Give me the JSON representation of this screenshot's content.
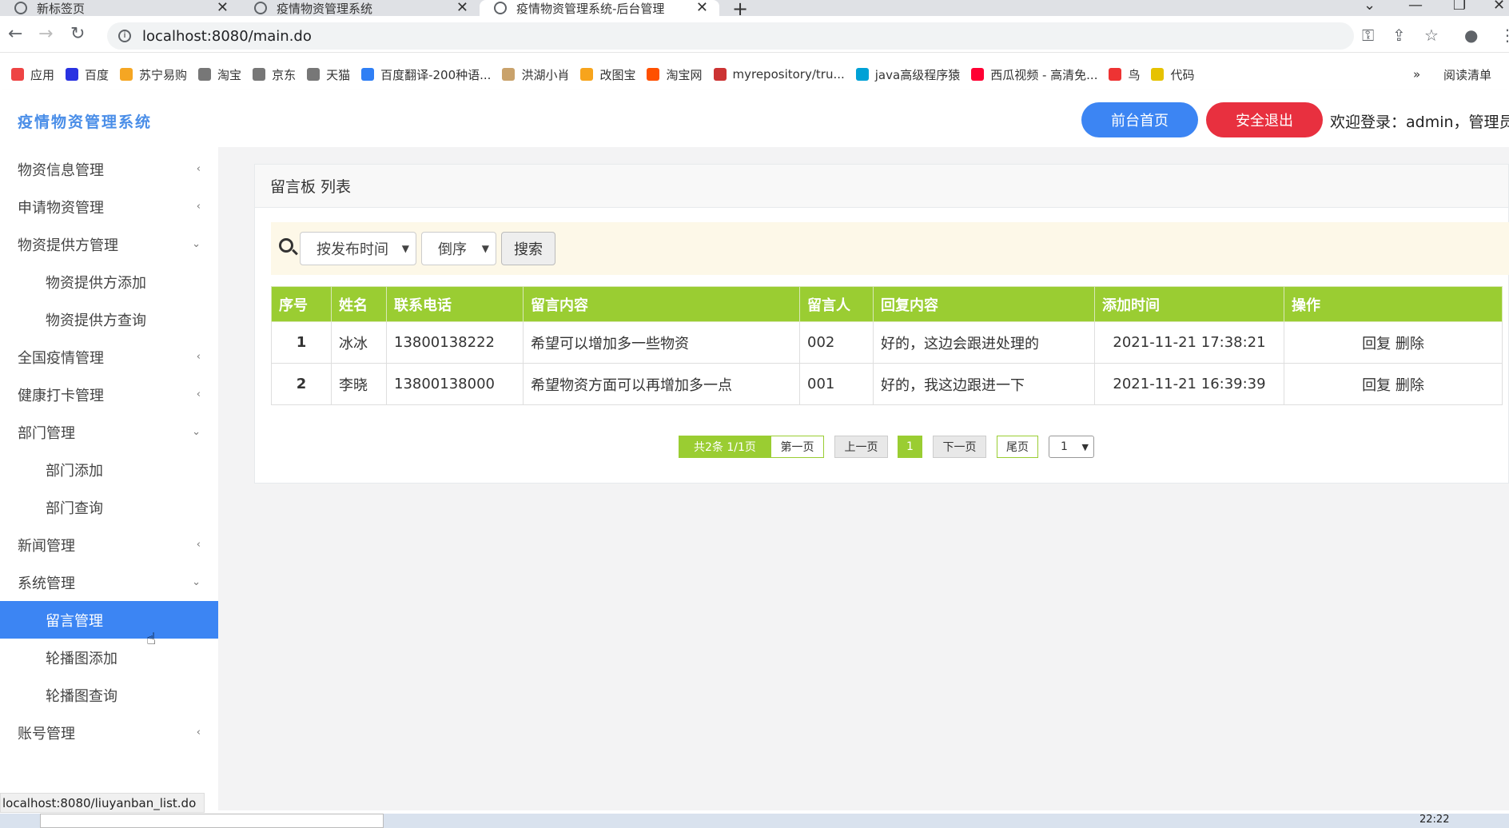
{
  "browser": {
    "tabs": [
      {
        "title": "新标签页"
      },
      {
        "title": "疫情物资管理系统"
      },
      {
        "title": "疫情物资管理系统-后台管理"
      }
    ],
    "url": "localhost:8080/main.do",
    "bookmarks": [
      {
        "label": "应用",
        "color": "#e44"
      },
      {
        "label": "百度",
        "color": "#2932e1"
      },
      {
        "label": "苏宁易购",
        "color": "#f5a623"
      },
      {
        "label": "淘宝",
        "color": "#777"
      },
      {
        "label": "京东",
        "color": "#777"
      },
      {
        "label": "天猫",
        "color": "#777"
      },
      {
        "label": "百度翻译-200种语...",
        "color": "#2f7ff5"
      },
      {
        "label": "洪湖小肖",
        "color": "#c9a26b"
      },
      {
        "label": "改图宝",
        "color": "#f7a41c"
      },
      {
        "label": "淘宝网",
        "color": "#ff5000"
      },
      {
        "label": "myrepository/tru...",
        "color": "#c33"
      },
      {
        "label": "java高级程序猿",
        "color": "#00a1d6"
      },
      {
        "label": "西瓜视频 - 高清免...",
        "color": "#f03"
      },
      {
        "label": "鸟",
        "color": "#e33"
      },
      {
        "label": "代码",
        "color": "#e6c200"
      }
    ],
    "reading_list": "阅读清单",
    "more": "»",
    "status_url": "localhost:8080/liuyanban_list.do"
  },
  "header": {
    "logo": "疫情物资管理系统",
    "home_btn": "前台首页",
    "logout_btn": "安全退出",
    "welcome": "欢迎登录：admin，管理员"
  },
  "sidebar": {
    "items": [
      {
        "label": "物资信息管理",
        "chevron": "‹"
      },
      {
        "label": "申请物资管理",
        "chevron": "‹"
      },
      {
        "label": "物资提供方管理",
        "chevron": "⌄"
      },
      {
        "label": "物资提供方添加"
      },
      {
        "label": "物资提供方查询"
      },
      {
        "label": "全国疫情管理",
        "chevron": "‹"
      },
      {
        "label": "健康打卡管理",
        "chevron": "‹"
      },
      {
        "label": "部门管理",
        "chevron": "⌄"
      },
      {
        "label": "部门添加"
      },
      {
        "label": "部门查询"
      },
      {
        "label": "新闻管理",
        "chevron": "‹"
      },
      {
        "label": "系统管理",
        "chevron": "⌄"
      },
      {
        "label": "留言管理"
      },
      {
        "label": "轮播图添加"
      },
      {
        "label": "轮播图查询"
      },
      {
        "label": "账号管理",
        "chevron": "‹"
      }
    ]
  },
  "panel": {
    "title": "留言板 列表",
    "sort_field": "按发布时间",
    "sort_order": "倒序",
    "search_btn": "搜索"
  },
  "table": {
    "headers": [
      "序号",
      "姓名",
      "联系电话",
      "留言内容",
      "留言人",
      "回复内容",
      "添加时间",
      "操作"
    ],
    "rows": [
      {
        "no": "1",
        "name": "冰冰",
        "phone": "13800138222",
        "content": "希望可以增加多一些物资",
        "author": "002",
        "reply": "好的，这边会跟进处理的",
        "time": "2021-11-21 17:38:21",
        "op_reply": "回复",
        "op_delete": "删除"
      },
      {
        "no": "2",
        "name": "李晓",
        "phone": "13800138000",
        "content": "希望物资方面可以再增加多一点",
        "author": "001",
        "reply": "好的，我这边跟进一下",
        "time": "2021-11-21 16:39:39",
        "op_reply": "回复",
        "op_delete": "删除"
      }
    ]
  },
  "pager": {
    "total": "共2条  1/1页",
    "first": "第一页",
    "prev": "上一页",
    "current": "1",
    "next": "下一页",
    "last": "尾页",
    "jump": "1"
  },
  "taskbar": {
    "clock": "22:22"
  },
  "colors": {
    "primary": "#3c85f3",
    "danger": "#e8303f",
    "table_header": "#9acd32"
  }
}
